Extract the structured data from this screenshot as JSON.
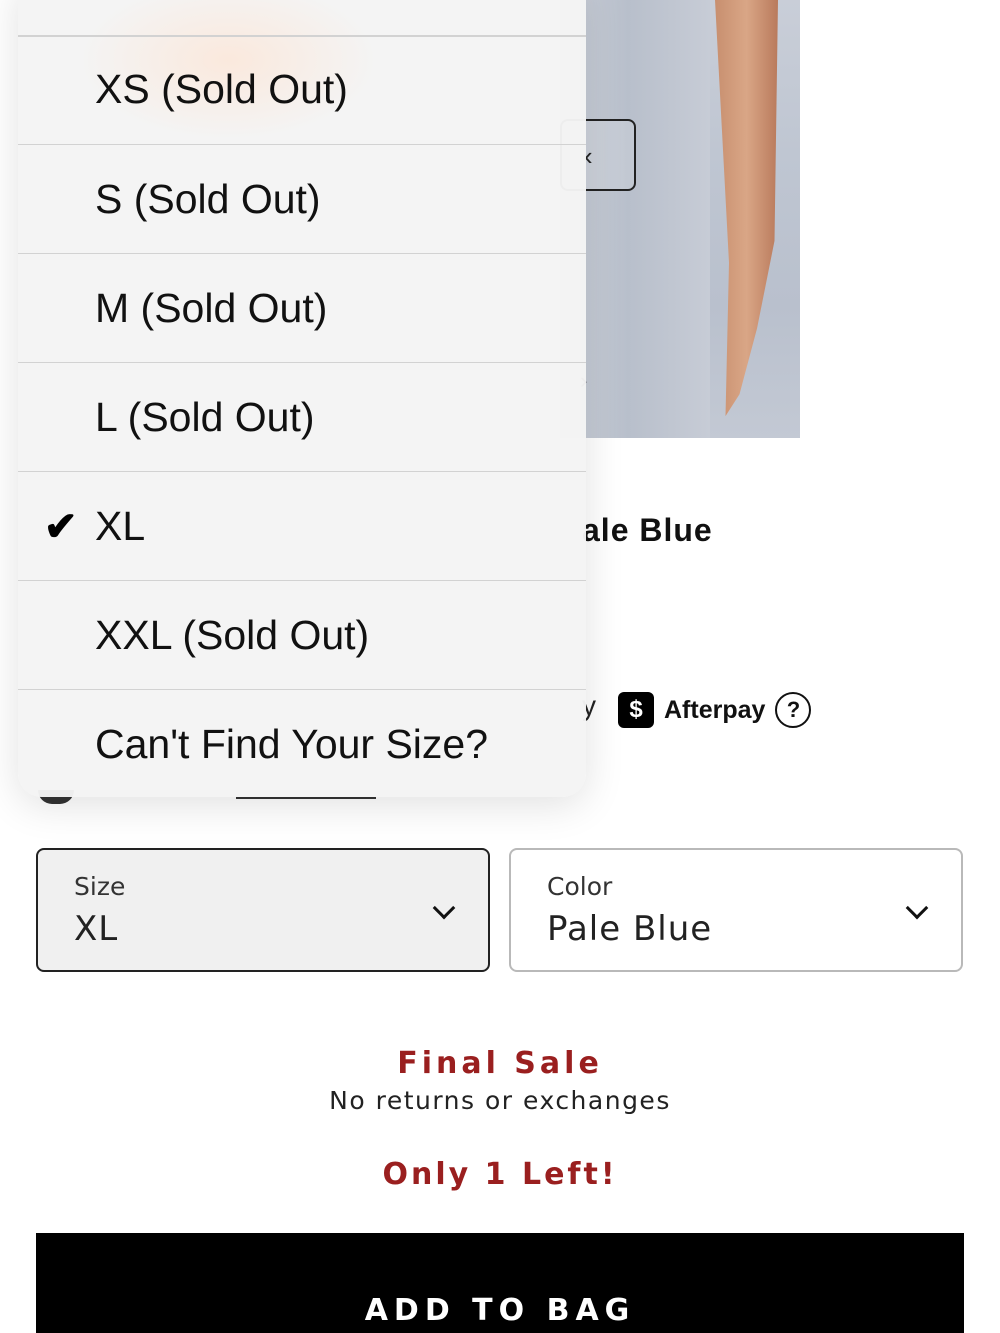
{
  "background": {
    "product_name_fragment": "ale Blue",
    "payment_fragment": "y",
    "afterpay_label": "Afterpay",
    "afterpay_badge": "$",
    "help_glyph": "?",
    "gallery_prev_glyph": "‹",
    "gallery_dot_glyph": "›"
  },
  "size_menu": {
    "items": [
      {
        "label": "XS (Sold Out)",
        "selected": false
      },
      {
        "label": "S (Sold Out)",
        "selected": false
      },
      {
        "label": "M (Sold Out)",
        "selected": false
      },
      {
        "label": "L (Sold Out)",
        "selected": false
      },
      {
        "label": "XL",
        "selected": true
      },
      {
        "label": "XXL (Sold Out)",
        "selected": false
      },
      {
        "label": "Can't Find Your Size?",
        "selected": false
      }
    ],
    "check_glyph": "✔"
  },
  "size_select": {
    "label": "Size",
    "value": "XL"
  },
  "color_select": {
    "label": "Color",
    "value": "Pale Blue"
  },
  "sale_info": {
    "final_sale": "Final Sale",
    "no_returns": "No returns or exchanges",
    "stock_note": "Only 1 Left!"
  },
  "add_to_bag": {
    "label": "ADD TO BAG"
  },
  "colors": {
    "sale_red": "#9a1f1f",
    "button_black": "#000000",
    "menu_bg": "#f4f4f4"
  },
  "icons": {
    "chevron": "chevron-down-icon",
    "check": "checkmark-icon",
    "afterpay": "afterpay-logo-icon",
    "help": "help-circle-icon"
  }
}
